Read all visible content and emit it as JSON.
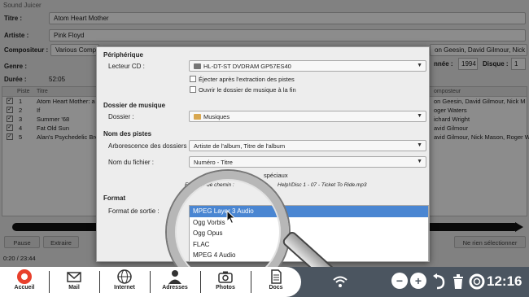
{
  "app": {
    "title": "Sound Juicer",
    "title_label": "Titre :",
    "title_value": "Atom Heart Mother",
    "artist_label": "Artiste :",
    "artist_value": "Pink Floyd",
    "composer_label": "Compositeur :",
    "composer_value": "Various Compo",
    "composer_right": "on Geesin, David Gilmour, Nick M",
    "genre_label": "Genre :",
    "annee_label": "nnée :",
    "annee_value": "1994",
    "disque_label": "Disque :",
    "disque_value": "1",
    "duree_label": "Durée :",
    "duree_value": "52:05",
    "tracks_header": {
      "piste": "Piste",
      "titre": "Titre",
      "compositeur": "omposteur"
    },
    "tracks": [
      {
        "num": "1",
        "title": "Atom Heart Mother: a",
        "composer": "on Geesin, David Gilmour, Nick M"
      },
      {
        "num": "2",
        "title": "If",
        "composer": "oger Waters"
      },
      {
        "num": "3",
        "title": "Summer '68",
        "composer": "ichard Wright"
      },
      {
        "num": "4",
        "title": "Fat Old Sun",
        "composer": "avid Gilmour"
      },
      {
        "num": "5",
        "title": "Alan's Psychedelic Bre",
        "composer": "avid Gilmour, Nick Mason, Roger W"
      }
    ],
    "pause_label": "Pause",
    "extract_label": "Extraire",
    "deselect_label": "Ne rien sélectionner",
    "elapsed": "0:20 / 23:44"
  },
  "dialog": {
    "peripheral_header": "Périphérique",
    "cd_reader_label": "Lecteur CD :",
    "cd_reader_value": "HL-DT-ST DVDRAM GP57ES40",
    "eject_label": "Éjecter après l'extraction des pistes",
    "open_folder_label": "Ouvrir le dossier de musique à la fin",
    "music_folder_header": "Dossier de musique",
    "folder_label": "Dossier :",
    "folder_value": "Musiques",
    "track_names_header": "Nom des pistes",
    "tree_label": "Arborescence des dossiers :",
    "tree_value": "Artiste de l'album, Titre de l'album",
    "filename_label": "Nom du fichier :",
    "filename_value": "Numéro - Titre",
    "special_chars_label": "spéciaux",
    "example_prefix": "Exemple de chemin :",
    "example_path": "Help!/Disc 1 - 07 - Ticket To Ride.mp3",
    "format_header": "Format",
    "output_format_label": "Format de sortie :",
    "formats": [
      "MPEG Layer 3 Audio",
      "Ogg Vorbis",
      "Ogg Opus",
      "FLAC",
      "MPEG 4 Audio"
    ],
    "selected_format": "MPEG Layer 3 Audio"
  },
  "taskbar": {
    "items": [
      {
        "label": "Accueil",
        "icon": "home-icon"
      },
      {
        "label": "Mail",
        "icon": "mail-icon"
      },
      {
        "label": "Internet",
        "icon": "globe-icon"
      },
      {
        "label": "Adresses",
        "icon": "contacts-icon"
      },
      {
        "label": "Photos",
        "icon": "camera-icon"
      },
      {
        "label": "Docs",
        "icon": "document-icon"
      }
    ],
    "clock": "12:16",
    "accent": "#4a86d2",
    "bar_color": "#4b5560"
  }
}
